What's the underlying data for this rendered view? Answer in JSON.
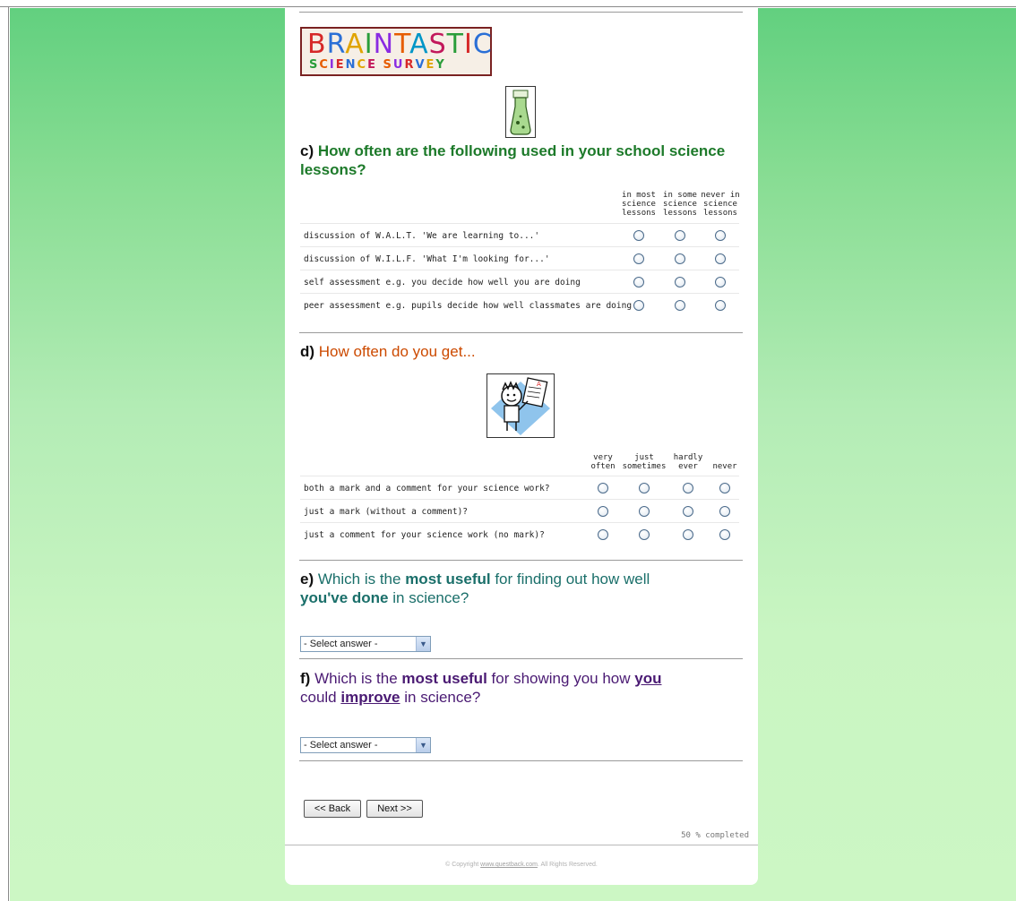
{
  "logo": {
    "line1": "BRAINTASTIC",
    "line2": "SCIENCE SURVEY"
  },
  "question_c": {
    "letter": "c)",
    "text": "How often are the following used in your school science lessons?",
    "columns": [
      {
        "line1": "in most",
        "line2": "science",
        "line3": "lessons"
      },
      {
        "line1": "in some",
        "line2": "science",
        "line3": "lessons"
      },
      {
        "line1": "never in",
        "line2": "science",
        "line3": "lessons"
      }
    ],
    "rows": [
      "discussion of W.A.L.T. 'We are learning to...'",
      "discussion of W.I.L.F. 'What I'm looking for...'",
      "self assessment e.g. you decide how well you are doing",
      "peer assessment e.g. pupils decide how well classmates are doing"
    ]
  },
  "question_d": {
    "letter": "d)",
    "text": "How often do you get...",
    "columns": [
      {
        "line1": "very",
        "line2": "often"
      },
      {
        "line1": "just",
        "line2": "sometimes"
      },
      {
        "line1": "hardly",
        "line2": "ever"
      },
      {
        "line1": "",
        "line2": "never"
      }
    ],
    "rows": [
      "both a mark and a comment for your science work?",
      "just a mark (without a comment)?",
      "just a comment for your science work (no mark)?"
    ]
  },
  "question_e": {
    "letter": "e)",
    "part1": "Which is the",
    "bold1": "most useful",
    "part2": "for finding out how well",
    "bold2": "you've done",
    "part3": "in science?",
    "select_value": "- Select answer -"
  },
  "question_f": {
    "letter": "f)",
    "part1": "Which is the",
    "bold1": "most useful",
    "part2": "for showing you how",
    "bold2": "you",
    "part3": "could",
    "bold3": "improve",
    "part4": "in science?",
    "select_value": "- Select answer -"
  },
  "nav": {
    "back_label": "<< Back",
    "next_label": "Next >>"
  },
  "progress_text": "50 % completed",
  "footer": {
    "pre": "© Copyright",
    "link": "www.questback.com",
    "post": ". All Rights Reserved."
  },
  "colors": {
    "green_heading": "#1d7a2a",
    "orange_heading": "#cc4a00",
    "teal_heading": "#1a6f6a",
    "purple_heading": "#4a1a73"
  }
}
